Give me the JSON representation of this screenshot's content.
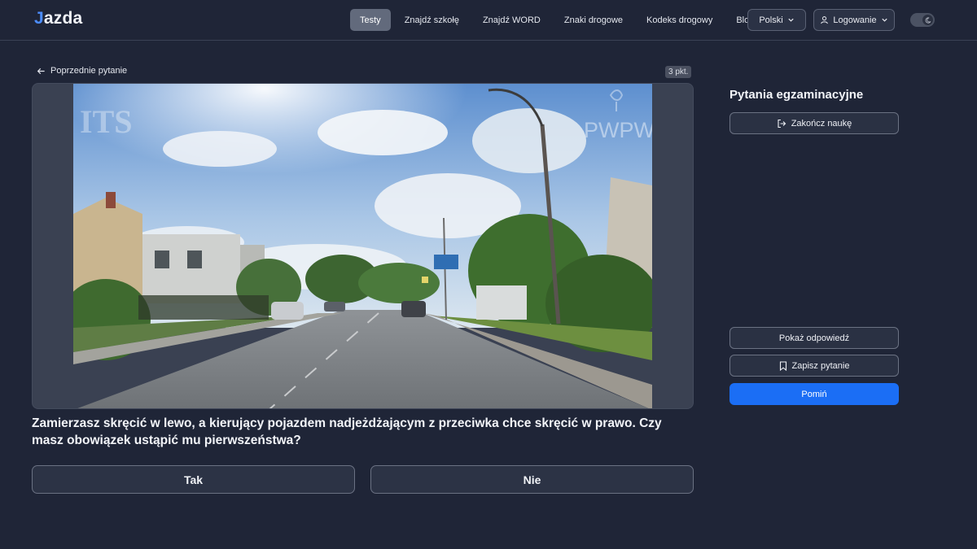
{
  "header": {
    "logo_j": "J",
    "logo_rest": "azda",
    "nav": [
      {
        "label": "Testy",
        "active": true
      },
      {
        "label": "Znajdź szkołę"
      },
      {
        "label": "Znajdź WORD"
      },
      {
        "label": "Znaki drogowe"
      },
      {
        "label": "Kodeks drogowy"
      },
      {
        "label": "Blog"
      }
    ],
    "language": "Polski",
    "login": "Logowanie",
    "theme_toggle_icon": "moon-icon"
  },
  "main": {
    "back_label": "Poprzednie pytanie",
    "points": "3 pkt.",
    "media": {
      "watermark_left": "ITS",
      "watermark_right": "PWPW"
    },
    "question": "Zamierzasz skręcić w lewo, a kierujący pojazdem nadjeżdżającym z przeciwka chce skręcić w prawo. Czy masz obowiązek ustąpić mu pierwszeństwa?",
    "answers": {
      "yes": "Tak",
      "no": "Nie"
    }
  },
  "sidebar": {
    "title": "Pytania egzaminacyjne",
    "end_button": "Zakończ naukę",
    "show_answer": "Pokaż odpowiedź",
    "save_question": "Zapisz pytanie",
    "skip": "Pomiń"
  },
  "colors": {
    "background": "#1f2537",
    "accent": "#1b6ef5",
    "logo_accent": "#4c8dff"
  }
}
